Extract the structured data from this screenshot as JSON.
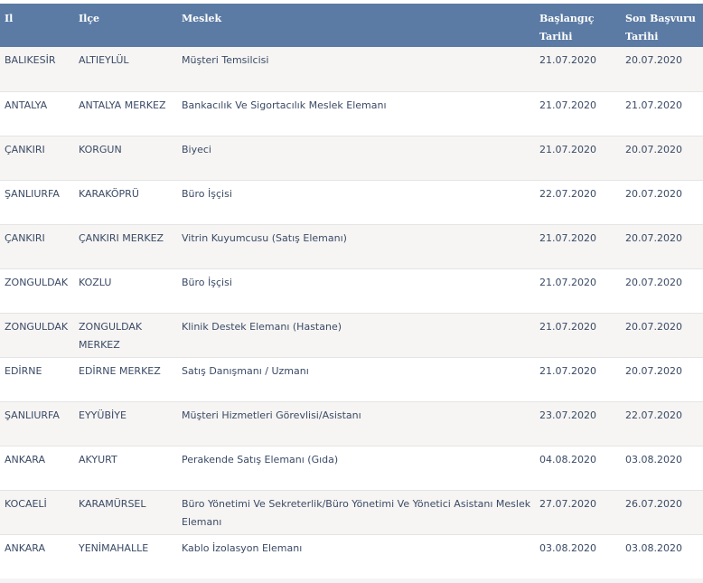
{
  "table": {
    "headers": {
      "il": "Il",
      "ilce": "Ilçe",
      "meslek": "Meslek",
      "baslangic": "Başlangıç Tarihi",
      "son_basvuru": "Son Başvuru Tarihi"
    },
    "rows": [
      {
        "il": "BALIKESİR",
        "ilce": "ALTIEYLÜL",
        "meslek": "Müşteri Temsilcisi",
        "baslangic": "21.07.2020",
        "son": "20.07.2020"
      },
      {
        "il": "ANTALYA",
        "ilce": "ANTALYA MERKEZ",
        "meslek": "Bankacılık Ve Sigortacılık Meslek Elemanı",
        "baslangic": "21.07.2020",
        "son": "21.07.2020"
      },
      {
        "il": "ÇANKIRI",
        "ilce": "KORGUN",
        "meslek": "Biyeci",
        "baslangic": "21.07.2020",
        "son": "20.07.2020"
      },
      {
        "il": "ŞANLIURFA",
        "ilce": "KARAKÖPRÜ",
        "meslek": "Büro İşçisi",
        "baslangic": "22.07.2020",
        "son": "20.07.2020"
      },
      {
        "il": "ÇANKIRI",
        "ilce": "ÇANKIRI MERKEZ",
        "meslek": "Vitrin Kuyumcusu (Satış Elemanı)",
        "baslangic": "21.07.2020",
        "son": "20.07.2020"
      },
      {
        "il": "ZONGULDAK",
        "ilce": "KOZLU",
        "meslek": "Büro İşçisi",
        "baslangic": "21.07.2020",
        "son": "20.07.2020"
      },
      {
        "il": "ZONGULDAK",
        "ilce": "ZONGULDAK MERKEZ",
        "meslek": "Klinik Destek Elemanı (Hastane)",
        "baslangic": "21.07.2020",
        "son": "20.07.2020"
      },
      {
        "il": "EDİRNE",
        "ilce": "EDİRNE MERKEZ",
        "meslek": "Satış Danışmanı / Uzmanı",
        "baslangic": "21.07.2020",
        "son": "20.07.2020"
      },
      {
        "il": "ŞANLIURFA",
        "ilce": "EYYÜBİYE",
        "meslek": "Müşteri Hizmetleri Görevlisi/Asistanı",
        "baslangic": "23.07.2020",
        "son": "22.07.2020"
      },
      {
        "il": "ANKARA",
        "ilce": "AKYURT",
        "meslek": "Perakende Satış Elemanı (Gıda)",
        "baslangic": "04.08.2020",
        "son": "03.08.2020"
      },
      {
        "il": "KOCAELİ",
        "ilce": "KARAMÜRSEL",
        "meslek": "Büro Yönetimi Ve Sekreterlik/Büro Yönetimi Ve Yönetici Asistanı Meslek Elemanı",
        "baslangic": "27.07.2020",
        "son": "26.07.2020"
      },
      {
        "il": "ANKARA",
        "ilce": "YENİMAHALLE",
        "meslek": "Kablo İzolasyon Elemanı",
        "baslangic": "03.08.2020",
        "son": "03.08.2020"
      }
    ]
  }
}
